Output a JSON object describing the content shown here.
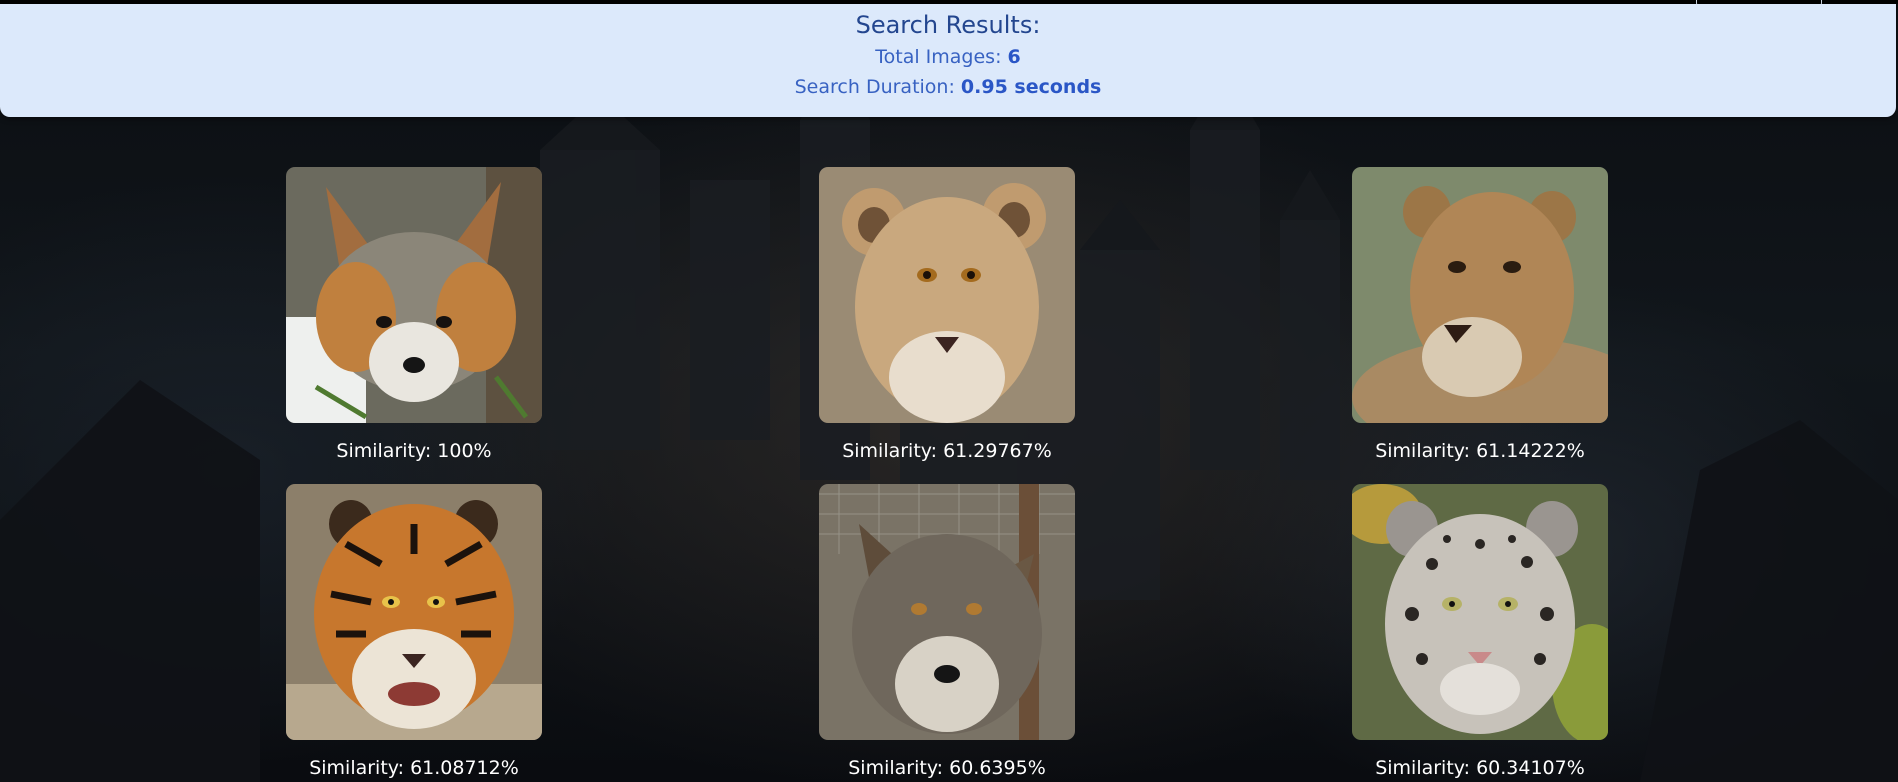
{
  "results": {
    "title": "Search Results:",
    "total_label": "Total Images:",
    "total_value": "6",
    "duration_label": "Search Duration:",
    "duration_value": "0.95 seconds"
  },
  "images": [
    {
      "alt": "gray fox",
      "similarity": "Similarity: 100%"
    },
    {
      "alt": "young lion",
      "similarity": "Similarity: 61.29767%"
    },
    {
      "alt": "lioness",
      "similarity": "Similarity: 61.14222%"
    },
    {
      "alt": "tiger",
      "similarity": "Similarity: 61.08712%"
    },
    {
      "alt": "gray wolf",
      "similarity": "Similarity: 60.6395%"
    },
    {
      "alt": "snow leopard",
      "similarity": "Similarity: 60.34107%"
    }
  ],
  "colors": {
    "panel_bg": "#dce9fb",
    "panel_text": "#3862c2",
    "page_bg": "#0c0f13",
    "caption": "#ffffff"
  }
}
